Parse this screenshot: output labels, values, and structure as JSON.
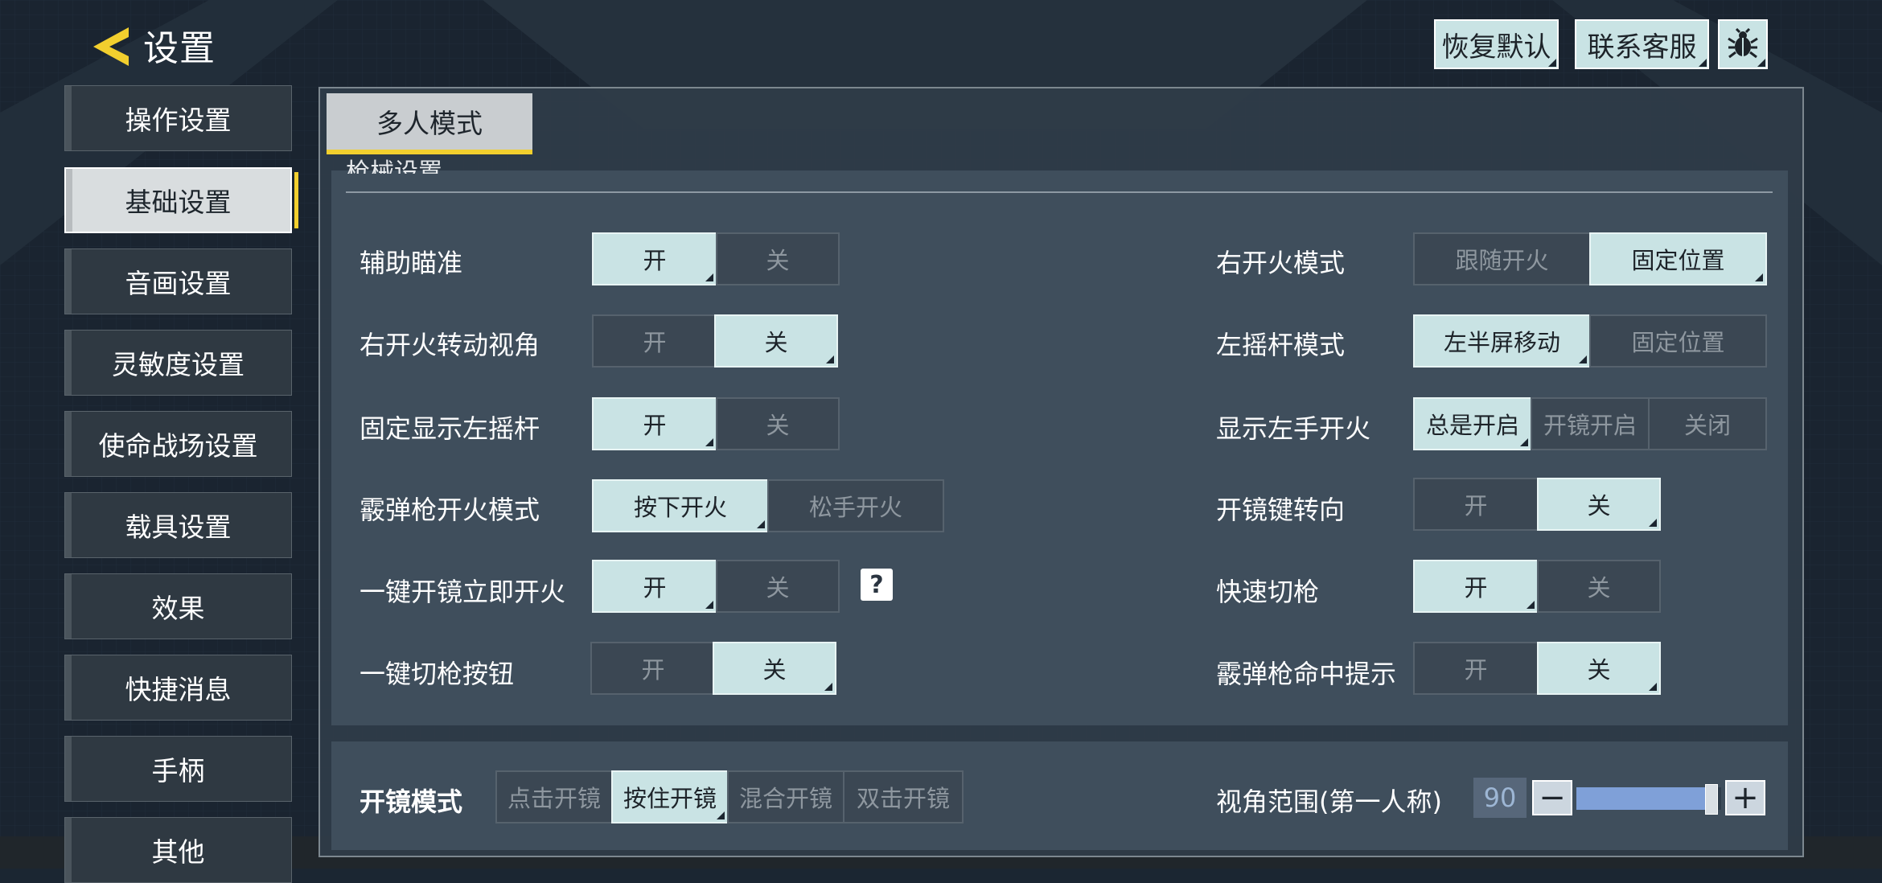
{
  "header": {
    "title": "设置",
    "restore_default": "恢复默认",
    "contact_support": "联系客服",
    "bug_icon": "bug-icon"
  },
  "sidebar": {
    "items": [
      {
        "label": "操作设置",
        "active": false
      },
      {
        "label": "基础设置",
        "active": true
      },
      {
        "label": "音画设置",
        "active": false
      },
      {
        "label": "灵敏度设置",
        "active": false
      },
      {
        "label": "使命战场设置",
        "active": false
      },
      {
        "label": "载具设置",
        "active": false
      },
      {
        "label": "效果",
        "active": false
      },
      {
        "label": "快捷消息",
        "active": false
      },
      {
        "label": "手柄",
        "active": false
      },
      {
        "label": "其他",
        "active": false
      }
    ]
  },
  "tabs": [
    {
      "label": "多人模式",
      "active": true
    }
  ],
  "section": {
    "heading": "枪械设置"
  },
  "settings_left": [
    {
      "label": "辅助瞄准",
      "options": [
        "开",
        "关"
      ],
      "selected": 0
    },
    {
      "label": "右开火转动视角",
      "options": [
        "开",
        "关"
      ],
      "selected": 1
    },
    {
      "label": "固定显示左摇杆",
      "options": [
        "开",
        "关"
      ],
      "selected": 0
    },
    {
      "label": "霰弹枪开火模式",
      "options": [
        "按下开火",
        "松手开火"
      ],
      "selected": 0
    },
    {
      "label": "一键开镜立即开火",
      "options": [
        "开",
        "关"
      ],
      "selected": 0,
      "help": "?"
    },
    {
      "label": "一键切枪按钮",
      "options": [
        "开",
        "关"
      ],
      "selected": 1
    }
  ],
  "settings_right": [
    {
      "label": "右开火模式",
      "options": [
        "跟随开火",
        "固定位置"
      ],
      "selected": 1
    },
    {
      "label": "左摇杆模式",
      "options": [
        "左半屏移动",
        "固定位置"
      ],
      "selected": 0
    },
    {
      "label": "显示左手开火",
      "options": [
        "总是开启",
        "开镜开启",
        "关闭"
      ],
      "selected": 0
    },
    {
      "label": "开镜键转向",
      "options": [
        "开",
        "关"
      ],
      "selected": 1
    },
    {
      "label": "快速切枪",
      "options": [
        "开",
        "关"
      ],
      "selected": 0
    },
    {
      "label": "霰弹枪命中提示",
      "options": [
        "开",
        "关"
      ],
      "selected": 1
    }
  ],
  "scope_mode": {
    "label": "开镜模式",
    "options": [
      "点击开镜",
      "按住开镜",
      "混合开镜",
      "双击开镜"
    ],
    "selected": 1
  },
  "fov": {
    "label": "视角范围(第一人称)",
    "value": "90",
    "minus": "−",
    "plus": "+",
    "fraction": 0.93
  },
  "colors": {
    "accent": "#f2cf2e",
    "selected_bg": "#c9e3e4",
    "panel_bg": "#3f4e5c",
    "slider_fill": "#7fa0d8"
  }
}
